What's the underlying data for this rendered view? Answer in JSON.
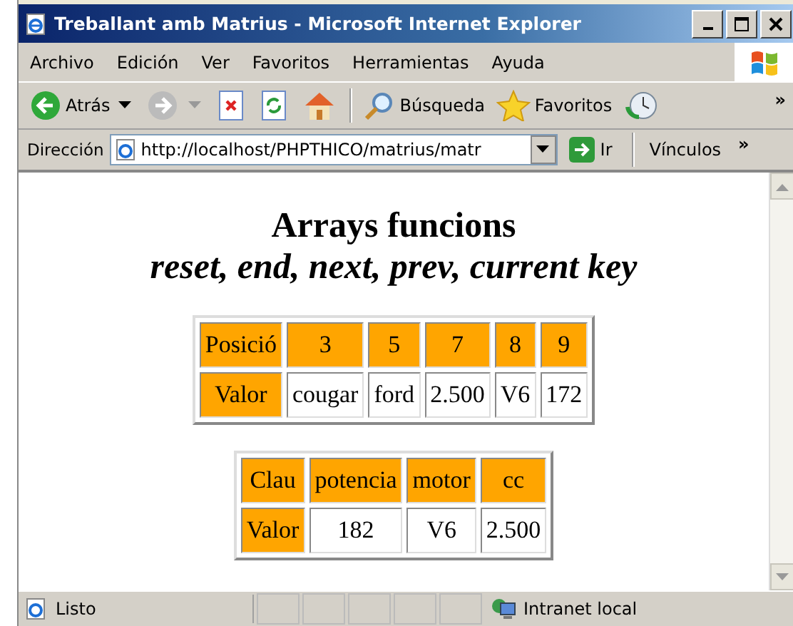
{
  "window": {
    "title": "Treballant amb Matrius - Microsoft Internet Explorer"
  },
  "menu": [
    "Archivo",
    "Edición",
    "Ver",
    "Favoritos",
    "Herramientas",
    "Ayuda"
  ],
  "toolbar": {
    "back": "Atrás",
    "search": "Búsqueda",
    "favorites": "Favoritos",
    "more": "»"
  },
  "address": {
    "label": "Dirección",
    "url": "http://localhost/PHPTHICO/matrius/matr",
    "go": "Ir",
    "links": "Vínculos",
    "more": "»"
  },
  "page": {
    "title": "Arrays funcions",
    "subtitle": "reset, end, next, prev, current key",
    "tables": [
      {
        "rows": [
          [
            {
              "text": "Posició",
              "header": true
            },
            {
              "text": "3",
              "header": true
            },
            {
              "text": "5",
              "header": true
            },
            {
              "text": "7",
              "header": true
            },
            {
              "text": "8",
              "header": true
            },
            {
              "text": "9",
              "header": true
            }
          ],
          [
            {
              "text": "Valor",
              "header": true
            },
            {
              "text": "cougar",
              "header": false
            },
            {
              "text": "ford",
              "header": false
            },
            {
              "text": "2.500",
              "header": false
            },
            {
              "text": "V6",
              "header": false
            },
            {
              "text": "172",
              "header": false
            }
          ]
        ]
      },
      {
        "rows": [
          [
            {
              "text": "Clau",
              "header": true
            },
            {
              "text": "potencia",
              "header": true
            },
            {
              "text": "motor",
              "header": true
            },
            {
              "text": "cc",
              "header": true
            }
          ],
          [
            {
              "text": "Valor",
              "header": true
            },
            {
              "text": "182",
              "header": false
            },
            {
              "text": "V6",
              "header": false
            },
            {
              "text": "2.500",
              "header": false
            }
          ]
        ]
      }
    ]
  },
  "status_bar": {
    "text": "Listo",
    "zone": "Intranet local"
  }
}
